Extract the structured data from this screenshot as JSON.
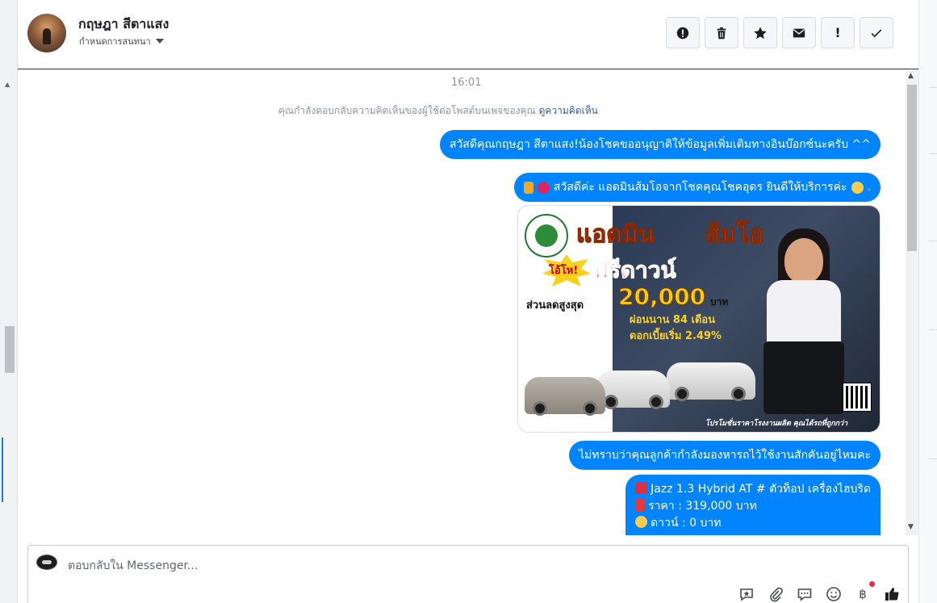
{
  "header": {
    "name": "กฤษฎา สีตาแสง",
    "assign_label": "กำหนดการสนทนา",
    "actions": [
      {
        "name": "report-button",
        "icon": "alert-circle-icon"
      },
      {
        "name": "delete-button",
        "icon": "trash-icon"
      },
      {
        "name": "star-button",
        "icon": "star-icon"
      },
      {
        "name": "mark-unread-button",
        "icon": "envelope-icon"
      },
      {
        "name": "follow-up-button",
        "icon": "exclamation-icon",
        "glyph": "!"
      },
      {
        "name": "done-button",
        "icon": "checkmark-icon"
      }
    ]
  },
  "chat": {
    "time": "16:01",
    "notice_text": "คุณกำลังตอบกลับความคิดเห็นของผู้ใช้ต่อโพสต์บนเพจของคุณ",
    "notice_link": "ดูความคิดเห็น",
    "messages": [
      {
        "text": "สวัสดีคุณกฤษฎา สีตาแสง!น้องโชคขออนุญาติให้ข้อมูลเพิ่มเติมทางอินบ๊อกซ์นะครับ ^^"
      },
      {
        "text": "สวัสดีค่ะ แอดมินส้มโอจากโชคคุณโชคอุดร ยินดีให้บริการค่ะ",
        "suffix": "."
      },
      {
        "text": "ไม่ทราบว่าคุณลูกค้ากำลังมองหารถไว้ใช้งานสักคันอยู่ไหมคะ"
      }
    ],
    "car_offer": {
      "line1": "Jazz 1.3 Hybrid AT # ตัวท็อป เครื่องไฮบริด",
      "line2": "ราคา : 319,000 บาท",
      "line3": "ดาวน์ : 0 บาท"
    },
    "promo": {
      "headline_1": "แอดมิน",
      "headline_2": "ส้มโอ",
      "burst": "โอ้โห!",
      "free_down": "ฟรีดาวน์",
      "discount_label": "ส่วนลดสูงสุด",
      "discount_amount": "20,000",
      "discount_unit": "บาท",
      "installment": "ผ่อนนาน 84 เดือน",
      "interest": "ดอกเบี้ยเริ่ม 2.49%",
      "footer": "โปรโมชั่นราคาโรงงานผลิต คุณได้รถที่ถูกกว่า"
    }
  },
  "composer": {
    "placeholder": "ตอบกลับใน Messenger...",
    "tools": [
      {
        "name": "saved-reply-button",
        "icon": "saved-reply-icon"
      },
      {
        "name": "attach-button",
        "icon": "paperclip-icon"
      },
      {
        "name": "quick-reply-button",
        "icon": "chat-bubble-icon"
      },
      {
        "name": "emoji-button",
        "icon": "smiley-icon"
      },
      {
        "name": "payment-button",
        "icon": "baht-icon",
        "glyph": "฿"
      },
      {
        "name": "like-button",
        "icon": "thumbs-up-icon"
      }
    ]
  },
  "colors": {
    "bubble": "#0084ff",
    "link": "#385898",
    "accent": "#1877f2"
  }
}
